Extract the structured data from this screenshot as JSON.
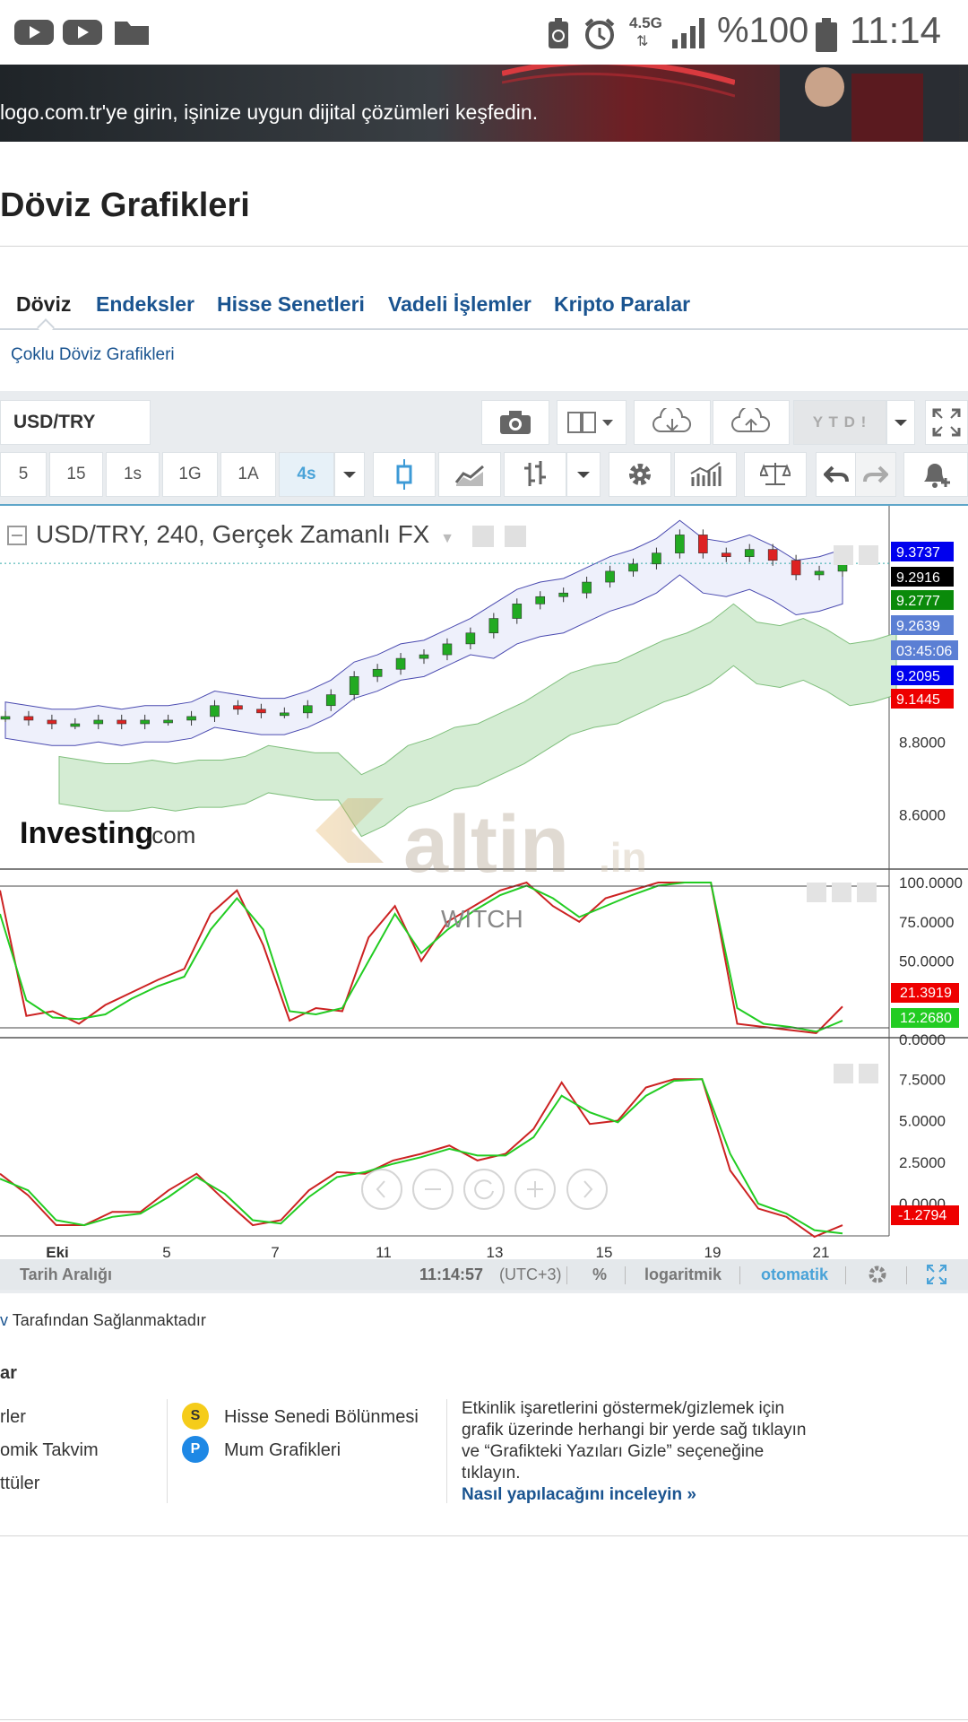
{
  "status_bar": {
    "network": "4.5G",
    "battery": "%100",
    "time": "11:14"
  },
  "banner": {
    "text": "logo.com.tr'ye girin, işinize uygun dijital çözümleri keşfedin."
  },
  "page": {
    "title": "Döviz Grafikleri",
    "tabs": [
      "Döviz",
      "Endeksler",
      "Hisse Senetleri",
      "Vadeli İşlemler",
      "Kripto Paralar"
    ],
    "sublink": "Çoklu Döviz Grafikleri"
  },
  "toolbar": {
    "symbol": "USD/TRY",
    "ytd": "Y T D !",
    "intervals": [
      "5",
      "15",
      "1s",
      "1G",
      "1A",
      "4s"
    ],
    "active_interval": "4s"
  },
  "chart_header": {
    "title": "USD/TRY, 240, Gerçek Zamanlı FX"
  },
  "watermarks": {
    "investing": "Investing",
    "investing_suffix": ".com",
    "altin": "altin",
    "altin_suffix": ".in",
    "witch": "WITCH"
  },
  "price_labels": [
    {
      "text": "9.3737",
      "color": "#0000ee"
    },
    {
      "text": "9.2916",
      "color": "#000000"
    },
    {
      "text": "9.2777",
      "color": "#0a8a0a"
    },
    {
      "text": "9.2639",
      "color": "#5b7fd4"
    },
    {
      "text": "03:45:06",
      "color": "#5b7fd4"
    },
    {
      "text": "9.2095",
      "color": "#0000ee"
    },
    {
      "text": "9.1445",
      "color": "#ee0000"
    }
  ],
  "chart_data": [
    {
      "type": "line",
      "panel": "price",
      "y_ticks": [
        "8.8000",
        "8.6000"
      ],
      "ylim": [
        8.45,
        9.45
      ],
      "x_ticks": [
        "Eki",
        "5",
        "7",
        "11",
        "13",
        "15",
        "19",
        "21"
      ],
      "series": [
        {
          "name": "",
          "values": [
            8.87,
            8.86,
            8.85,
            8.85,
            8.86,
            8.85,
            8.86,
            8.86,
            8.87,
            8.9,
            8.89,
            8.88,
            8.88,
            8.9,
            8.93,
            8.98,
            9.0,
            9.03,
            9.04,
            9.07,
            9.1,
            9.14,
            9.18,
            9.2,
            9.21,
            9.24,
            9.27,
            9.29,
            9.32,
            9.37,
            9.32,
            9.31,
            9.33,
            9.3,
            9.26,
            9.27,
            9.29
          ]
        }
      ]
    },
    {
      "type": "line",
      "panel": "oscillator-1",
      "y_ticks": [
        "100.0000",
        "75.0000",
        "50.0000",
        "0.0000"
      ],
      "ylim": [
        0,
        100
      ],
      "value_labels": [
        {
          "text": "21.3919",
          "color": "#ee0000"
        },
        {
          "text": "12.2680",
          "color": "#22cc22"
        }
      ],
      "series": [
        {
          "name": "",
          "color": "#cc2222",
          "values": [
            95,
            15,
            18,
            10,
            22,
            30,
            38,
            45,
            80,
            95,
            60,
            12,
            20,
            18,
            65,
            85,
            50,
            75,
            85,
            95,
            100,
            85,
            75,
            90,
            95,
            100,
            100,
            100,
            10,
            8,
            6,
            4,
            21
          ]
        },
        {
          "name": "",
          "color": "#22cc22",
          "values": [
            80,
            25,
            14,
            13,
            16,
            26,
            34,
            40,
            70,
            90,
            70,
            18,
            16,
            20,
            50,
            80,
            55,
            70,
            82,
            92,
            98,
            90,
            78,
            85,
            92,
            98,
            100,
            100,
            20,
            10,
            8,
            5,
            12
          ]
        }
      ]
    },
    {
      "type": "line",
      "panel": "oscillator-2",
      "y_ticks": [
        "7.5000",
        "5.0000",
        "2.5000",
        "0.0000"
      ],
      "ylim": [
        -2.0,
        8.0
      ],
      "value_labels": [
        {
          "text": "-1.2794",
          "color": "#ee0000"
        }
      ],
      "series": [
        {
          "name": "",
          "color": "#cc2222",
          "values": [
            1.8,
            0.5,
            -1.3,
            -1.3,
            -0.5,
            -0.5,
            0.8,
            1.8,
            0.2,
            -1.3,
            -1.0,
            0.8,
            1.9,
            1.8,
            2.6,
            3.0,
            3.5,
            2.6,
            3.0,
            4.5,
            7.3,
            4.8,
            5.0,
            7.0,
            7.5,
            7.5,
            2.0,
            -0.3,
            -0.8,
            -2.0,
            -1.3
          ]
        },
        {
          "name": "",
          "color": "#22cc22",
          "values": [
            1.5,
            0.8,
            -1.0,
            -1.3,
            -0.8,
            -0.6,
            0.4,
            1.6,
            0.6,
            -1.0,
            -1.2,
            0.4,
            1.6,
            1.9,
            2.4,
            2.8,
            3.3,
            2.9,
            2.9,
            4.0,
            6.5,
            5.5,
            4.9,
            6.5,
            7.4,
            7.5,
            3.0,
            0.0,
            -0.6,
            -1.6,
            -1.8
          ]
        }
      ]
    }
  ],
  "chart_footer": {
    "range": "Tarih Aralığı",
    "clock": "11:14:57",
    "tz": "(UTC+3)",
    "percent": "%",
    "log": "logaritmik",
    "auto": "otomatik"
  },
  "provided_by": "Tarafından Sağlanmaktadır",
  "legend": {
    "heading": "ar",
    "left_items": [
      "rler",
      "omik Takvim",
      "ttüler"
    ],
    "items": [
      {
        "badge": "S",
        "label": "Hisse Senedi Bölünmesi",
        "color": "#f5cc1a"
      },
      {
        "badge": "P",
        "label": "Mum Grafikleri",
        "color": "#1e88e5"
      }
    ],
    "info_lines": [
      "Etkinlik işaretlerini göstermek/gizlemek için",
      "grafik üzerinde herhangi bir yerde sağ tıklayın",
      "ve “Grafikteki Yazıları Gizle” seçeneğine",
      "tıklayın."
    ],
    "info_link": "Nasıl yapılacağını inceleyin »"
  }
}
